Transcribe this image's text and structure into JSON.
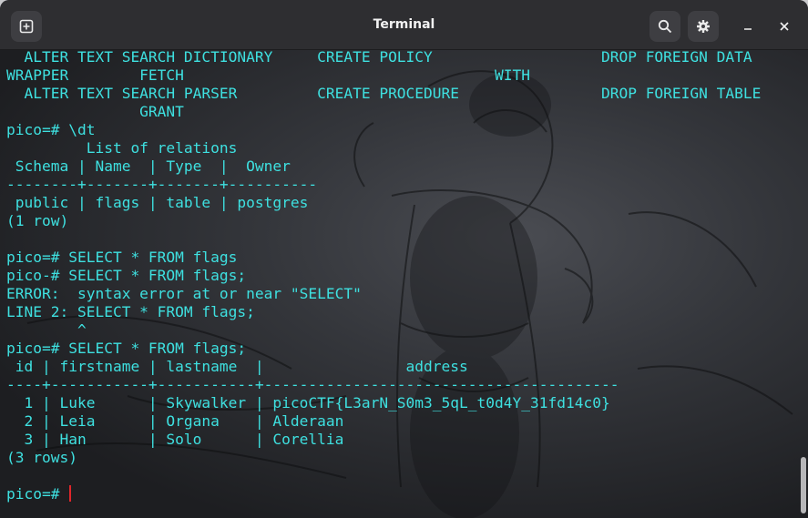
{
  "window": {
    "title": "Terminal"
  },
  "icons": {
    "new_tab": "new-tab-icon",
    "search": "search-icon",
    "menu": "gear-icon",
    "minimize": "minimize-icon",
    "close": "close-icon"
  },
  "terminal": {
    "lines": [
      "  ALTER TEXT SEARCH DICTIONARY     CREATE POLICY                   DROP FOREIGN DATA",
      "WRAPPER        FETCH                                   WITH",
      "  ALTER TEXT SEARCH PARSER         CREATE PROCEDURE                DROP FOREIGN TABLE",
      "               GRANT",
      "pico=# \\dt",
      "         List of relations",
      " Schema | Name  | Type  |  Owner",
      "--------+-------+-------+----------",
      " public | flags | table | postgres",
      "(1 row)",
      "",
      "pico=# SELECT * FROM flags",
      "pico-# SELECT * FROM flags;",
      "ERROR:  syntax error at or near \"SELECT\"",
      "LINE 2: SELECT * FROM flags;",
      "        ^",
      "pico=# SELECT * FROM flags;",
      " id | firstname | lastname  |                address",
      "----+-----------+-----------+----------------------------------------",
      "  1 | Luke      | Skywalker | picoCTF{L3arN_S0m3_5qL_t0d4Y_31fd14c0}",
      "  2 | Leia      | Organa    | Alderaan",
      "  3 | Han       | Solo      | Corellia",
      "(3 rows)",
      ""
    ],
    "prompt": "pico=# "
  },
  "colors": {
    "text": "#3ee0e0",
    "cursor": "#e0262b",
    "background": "#1d1e21",
    "titlebar": "#2e2e31"
  }
}
